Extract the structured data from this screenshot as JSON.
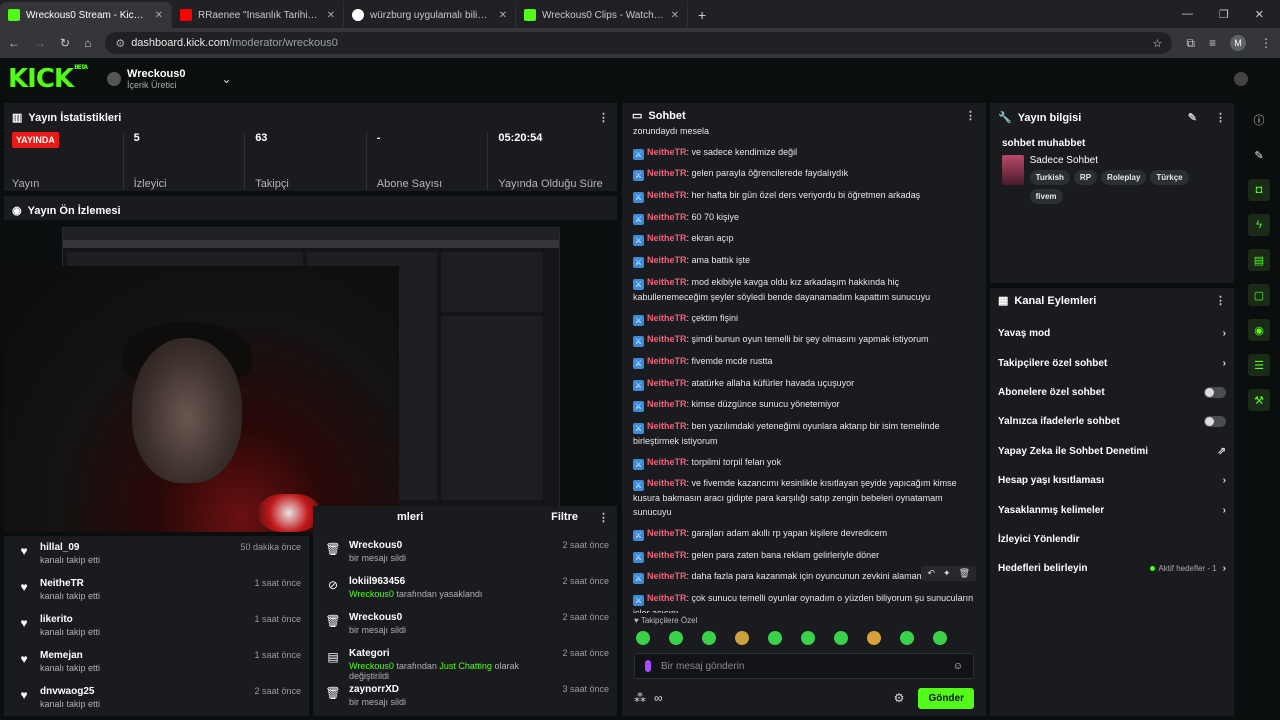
{
  "browser": {
    "tabs": [
      {
        "title": "Wreckous0 Stream - Kick Dashb",
        "color": "#53fc18",
        "active": true
      },
      {
        "title": "RRaenee \"İnsanlık Tarihinin En T",
        "color": "#ff0000",
        "active": false
      },
      {
        "title": "würzburg uygulamalı bilimler ü",
        "color": "#ffffff",
        "active": false
      },
      {
        "title": "Wreckous0 Clips - Watch Live o",
        "color": "#53fc18",
        "active": false
      }
    ],
    "url_host": "dashboard.kick.com",
    "url_path": "/moderator/wreckous0",
    "profile_initial": "M"
  },
  "header": {
    "logo": "KICK",
    "beta": "BETA",
    "channel_name": "Wreckous0",
    "channel_role": "İçerik Üretici"
  },
  "stats": {
    "title": "Yayın İstatistikleri",
    "live": "YAYINDA",
    "live_label": "Yayın",
    "viewers": "5",
    "viewers_label": "İzleyici",
    "followers": "63",
    "followers_label": "Takipçi",
    "subs": "-",
    "subs_label": "Abone Sayısı",
    "uptime": "05:20:54",
    "uptime_label": "Yayında Olduğu Süre"
  },
  "preview": {
    "title": "Yayın Ön İzlemesi"
  },
  "follows": [
    {
      "name": "hillal_09",
      "sub": "kanalı takip etti",
      "time": "50 dakika önce"
    },
    {
      "name": "NeitheTR",
      "sub": "kanalı takip etti",
      "time": "1 saat önce"
    },
    {
      "name": "likerito",
      "sub": "kanalı takip etti",
      "time": "1 saat önce"
    },
    {
      "name": "Memejan",
      "sub": "kanalı takip etti",
      "time": "1 saat önce"
    },
    {
      "name": "dnvwaog25",
      "sub": "kanalı takip etti",
      "time": "2 saat önce"
    }
  ],
  "modlog": {
    "title_partial": "mleri",
    "filter": "Filtre",
    "items": [
      {
        "icon": "trash",
        "name": "Wreckous0",
        "pre": "",
        "hl": "",
        "sub": "bir mesajı sildi",
        "time": "2 saat önce"
      },
      {
        "icon": "ban",
        "name": "lokiil963456",
        "pre": "",
        "hl": "Wreckous0",
        "sub": " tarafından yasaklandı",
        "time": "2 saat önce"
      },
      {
        "icon": "trash",
        "name": "Wreckous0",
        "pre": "",
        "hl": "",
        "sub": "bir mesajı sildi",
        "time": "2 saat önce"
      },
      {
        "icon": "category",
        "name": "Kategori",
        "pre": "",
        "hl": "Wreckous0",
        "sub": " tarafından ",
        "hl2": "Just Chatting",
        "sub2": " olarak değiştirildi",
        "time": "2 saat önce"
      },
      {
        "icon": "trash",
        "name": "zaynorrXD",
        "pre": "",
        "hl": "",
        "sub": "bir mesajı sildi",
        "time": "3 saat önce"
      }
    ]
  },
  "chat": {
    "title": "Sohbet",
    "top_cut": "zorundaydı mesela",
    "messages": [
      {
        "user": "NeitheTR",
        "text": "ve sadece kendimize değil"
      },
      {
        "user": "NeitheTR",
        "text": "gelen parayla öğrencilerede faydalıydık"
      },
      {
        "user": "NeitheTR",
        "text": "her hafta bir gün özel ders veriyordu bi öğretmen arkadaş"
      },
      {
        "user": "NeitheTR",
        "text": "60 70 kişiye"
      },
      {
        "user": "NeitheTR",
        "text": "ekran açıp"
      },
      {
        "user": "NeitheTR",
        "text": "ama battık işte"
      },
      {
        "user": "NeitheTR",
        "text": "mod ekibiyle kavga oldu kız arkadaşım hakkında hiç kabullenemeceğim şeyler söyledi bende dayanamadım kapattım sunucuyu"
      },
      {
        "user": "NeitheTR",
        "text": "çektim fişini"
      },
      {
        "user": "NeitheTR",
        "text": "şimdi bunun oyun temelli bir şey olmasını yapmak istiyorum"
      },
      {
        "user": "NeitheTR",
        "text": "fivemde mcde rustta"
      },
      {
        "user": "NeitheTR",
        "text": "atatürke allaha küfürler havada uçuşuyor"
      },
      {
        "user": "NeitheTR",
        "text": "kimse düzgünce sunucu yönetemiyor"
      },
      {
        "user": "NeitheTR",
        "text": "ben yazılımdaki yeteneğimi oyunlara aktarıp bir isim temelinde birleştirmek istiyorum"
      },
      {
        "user": "NeitheTR",
        "text": "torpilmi torpil felan yok"
      },
      {
        "user": "NeitheTR",
        "text": "ve fivemde kazancımı kesinlikle kısıtlayan şeyide yapıcağım kimse kusura bakmasın aracı gidipte para karşılığı satıp zengin bebeleri oynatamam sunucuyu"
      },
      {
        "user": "NeitheTR",
        "text": "garajları adam akıllı rp yapan kişilere devredicem"
      },
      {
        "user": "NeitheTR",
        "text": "gelen para zaten bana reklam gelirleriyle döner"
      },
      {
        "user": "NeitheTR",
        "text": "daha fazla para kazanmak için oyuncunun zevkini alamam"
      },
      {
        "user": "NeitheTR",
        "text": "çok sunucu temelli oyunlar oynadım o yüzden biliyorum şu sunucuların içler acısını"
      }
    ],
    "mode": "Takipçilere Özel",
    "placeholder": "Bir mesaj gönderin",
    "send": "Gönder"
  },
  "stream_info": {
    "title": "Yayın bilgisi",
    "stream_title": "sohbet muhabbet",
    "category": "Sadece Sohbet",
    "tags": [
      "Turkish",
      "RP",
      "Roleplay",
      "Türkçe",
      "fivem"
    ]
  },
  "actions": {
    "title": "Kanal Eylemleri",
    "items": [
      {
        "label": "Yavaş mod",
        "kind": "arrow"
      },
      {
        "label": "Takipçilere özel sohbet",
        "kind": "arrow"
      },
      {
        "label": "Abonelere özel sohbet",
        "kind": "toggle"
      },
      {
        "label": "Yalnızca ifadelerle sohbet",
        "kind": "toggle"
      },
      {
        "label": "Yapay Zeka ile Sohbet Denetimi",
        "kind": "external"
      },
      {
        "label": "Hesap yaşı kısıtlaması",
        "kind": "arrow"
      },
      {
        "label": "Yasaklanmış kelimeler",
        "kind": "arrow"
      },
      {
        "label": "İzleyici Yönlendir",
        "kind": "none"
      },
      {
        "label": "Hedefleri belirleyin",
        "kind": "goal",
        "goal": "Aktif hedefler - 1"
      }
    ]
  },
  "colors": {
    "accent": "#53fc18",
    "live": "#e91916",
    "username": "#f3607b"
  }
}
